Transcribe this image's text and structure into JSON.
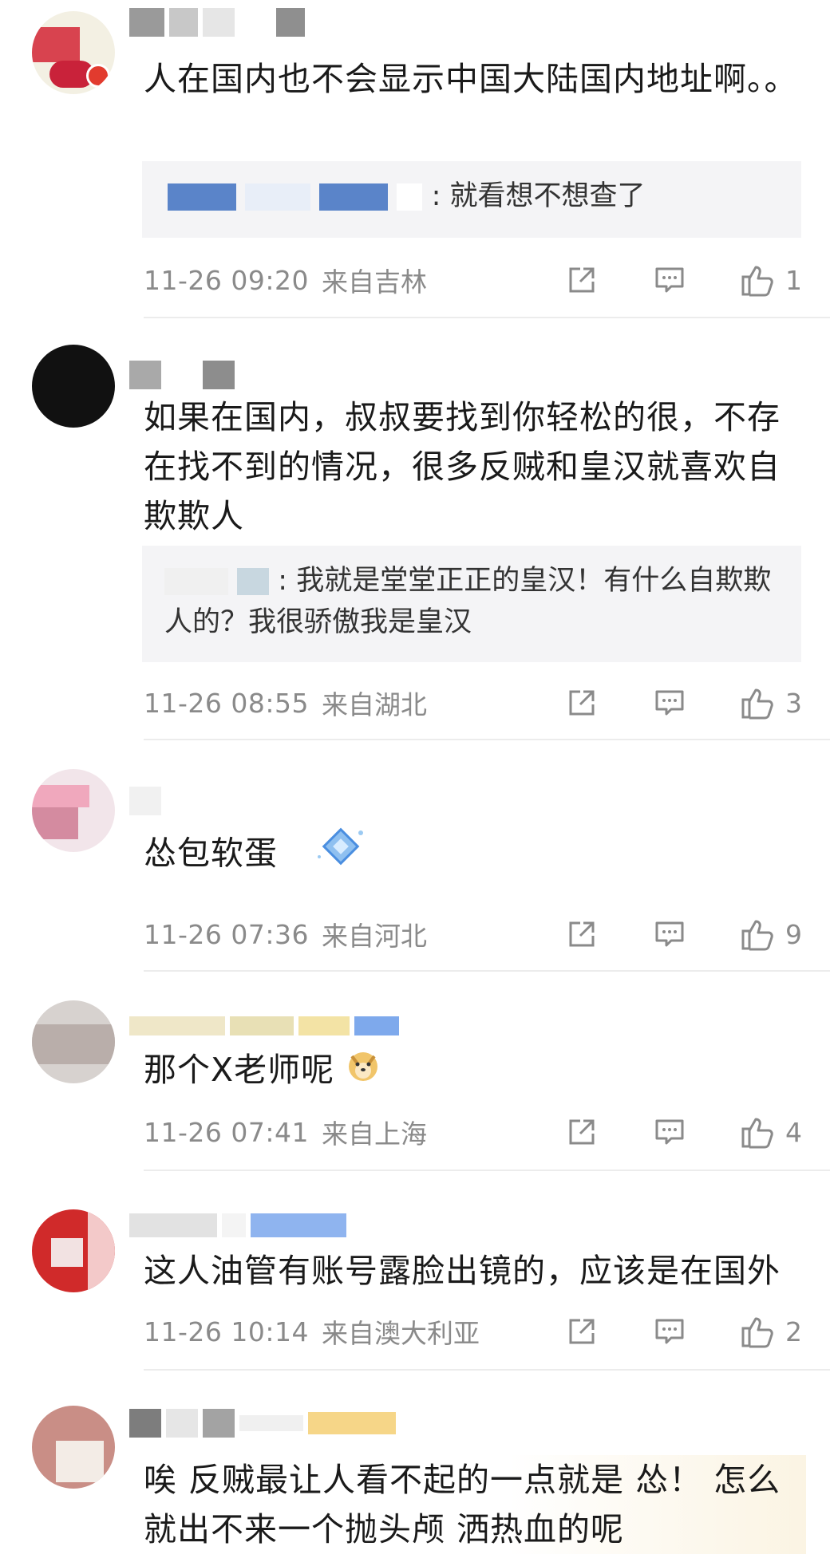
{
  "comments": [
    {
      "content": "人在国内也不会显示中国大陆国内地址啊。。",
      "reply": "就看想不想查了",
      "timestamp": "11-26 09:20",
      "location": "来自吉林",
      "likes": "1"
    },
    {
      "content": "如果在国内，叔叔要找到你轻松的很，不存在找不到的情况，很多反贼和皇汉就喜欢自欺欺人",
      "reply": "我就是堂堂正正的皇汉！有什么自欺欺人的？我很骄傲我是皇汉",
      "timestamp": "11-26 08:55",
      "location": "来自湖北",
      "likes": "3"
    },
    {
      "content": "怂包软蛋",
      "timestamp": "11-26 07:36",
      "location": "来自河北",
      "likes": "9"
    },
    {
      "content": "那个X老师呢",
      "timestamp": "11-26 07:41",
      "location": "来自上海",
      "likes": "4"
    },
    {
      "content": "这人油管有账号露脸出镜的，应该是在国外",
      "timestamp": "11-26 10:14",
      "location": "来自澳大利亚",
      "likes": "2"
    },
    {
      "content": "唉  反贼最让人看不起的一点就是 怂！ 怎么就出不来一个抛头颅 洒热血的呢"
    }
  ],
  "icons": {
    "share": "share-icon",
    "reply": "comment-icon",
    "like": "thumbs-up-icon"
  },
  "colors": {
    "meta_text": "#8a8a8a",
    "reply_bg": "#f4f4f6",
    "divider": "#ececec"
  }
}
